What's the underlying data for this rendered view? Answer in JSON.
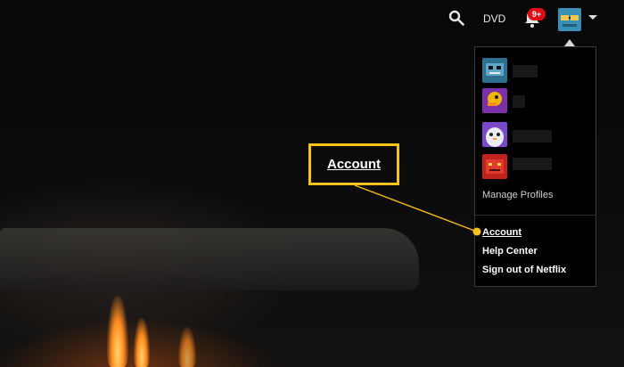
{
  "header": {
    "dvd_label": "DVD",
    "notification_count": "9+"
  },
  "menu": {
    "manage_profiles": "Manage Profiles",
    "account": "Account",
    "help_center": "Help Center",
    "sign_out": "Sign out of Netflix"
  },
  "callout": {
    "label": "Account",
    "color": "#f7c21a"
  },
  "profiles": [
    {
      "icon": "robot-avatar-icon",
      "color": "#2f6f8f"
    },
    {
      "icon": "duck-avatar-icon",
      "color": "#7b2fa8"
    },
    {
      "icon": "penguin-avatar-icon",
      "color": "#7a48c9"
    },
    {
      "icon": "monster-avatar-icon",
      "color": "#c0221d"
    }
  ],
  "colors": {
    "badge": "#e50914"
  }
}
